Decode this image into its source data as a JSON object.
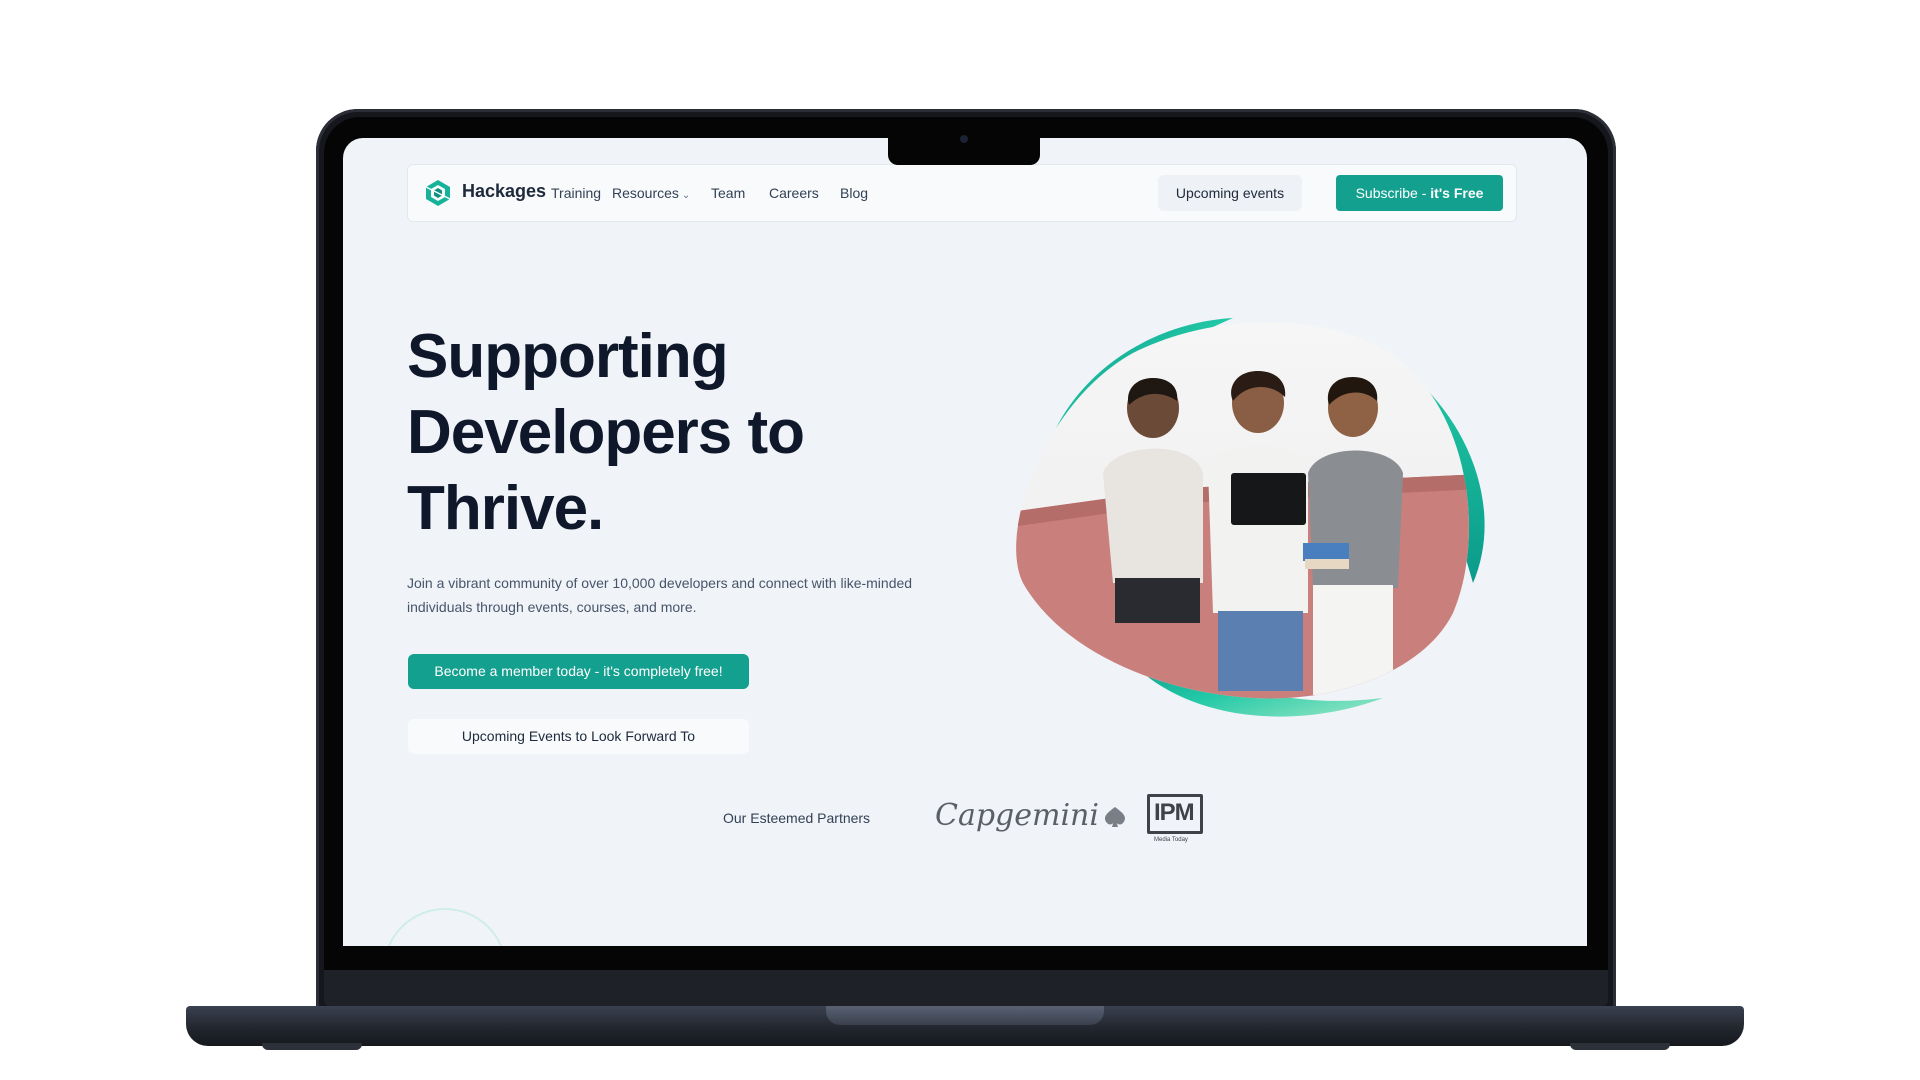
{
  "nav": {
    "brand": "Hackages",
    "links": [
      "Training",
      "Resources",
      "Team",
      "Careers",
      "Blog"
    ],
    "events_button": "Upcoming events",
    "subscribe_prefix": "Subscribe - ",
    "subscribe_bold": "it's Free"
  },
  "hero": {
    "title_line1": "Supporting",
    "title_line2": "Developers to",
    "title_line3": "Thrive.",
    "description": "Join a vibrant community of over 10,000 developers and connect with like-minded individuals through events, courses, and more.",
    "cta_primary": "Become a member today - it's completely free!",
    "cta_secondary": "Upcoming Events to Look Forward To"
  },
  "partners": {
    "label": "Our Esteemed Partners",
    "logos": [
      "Capgemini",
      "IPM"
    ],
    "ipm_tagline": "Media Today"
  },
  "colors": {
    "accent": "#14a08f",
    "background": "#f0f3f8",
    "heading": "#0f172a"
  },
  "icons": [
    "hackages-logo-icon",
    "chevron-down-icon",
    "capgemini-spade-icon"
  ]
}
